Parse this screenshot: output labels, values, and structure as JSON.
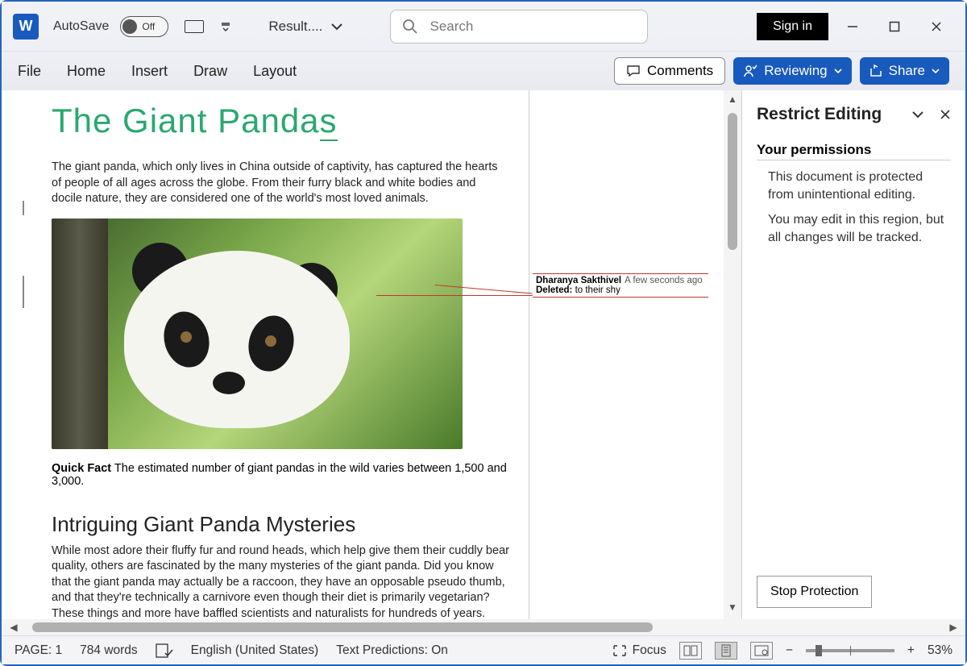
{
  "titlebar": {
    "autosave_label": "AutoSave",
    "autosave_state": "Off",
    "doc_name": "Result....",
    "search_placeholder": "Search",
    "signin": "Sign in"
  },
  "tabs": {
    "file": "File",
    "home": "Home",
    "insert": "Insert",
    "draw": "Draw",
    "layout": "Layout"
  },
  "right_buttons": {
    "comments": "Comments",
    "reviewing": "Reviewing",
    "share": "Share"
  },
  "document": {
    "title_main": "The Giant Panda",
    "title_last": "s",
    "para1": "The giant panda, which only lives in China outside of captivity, has captured the hearts of people of all ages across the globe. From their furry black and white bodies and docile nature, they are considered one of the world's most loved animals.",
    "quickfact_label": "Quick Fact",
    "quickfact_text": " The estimated number of giant pandas in the wild varies between 1,500 and 3,000.",
    "subheading": "Intriguing Giant Panda Mysteries",
    "para2": "While most adore their fluffy fur and round heads, which help give them their cuddly bear quality, others are fascinated by the many mysteries of the giant panda. Did you know that the giant panda may actually be a raccoon, they have an opposable pseudo thumb, and that they're technically a carnivore even though their diet is primarily vegetarian? These things and more have baffled scientists and naturalists for hundreds of years."
  },
  "track_change": {
    "author": "Dharanya Sakthivel",
    "when": "A few seconds ago",
    "action": "Deleted:",
    "content": " to their shy"
  },
  "pane": {
    "title": "Restrict Editing",
    "section": "Your permissions",
    "line1": "This document is protected from unintentional editing.",
    "line2": "You may edit in this region, but all changes will be tracked.",
    "stop": "Stop Protection"
  },
  "status": {
    "page": "PAGE: 1",
    "words": "784 words",
    "lang": "English (United States)",
    "predictions": "Text Predictions: On",
    "focus": "Focus",
    "zoom": "53%"
  }
}
